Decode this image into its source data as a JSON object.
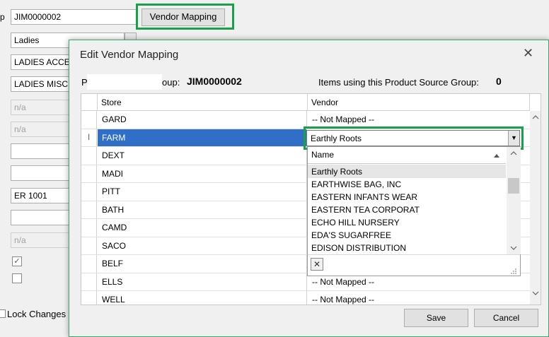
{
  "background": {
    "label_fragment": "p",
    "code_value": "JIM0000002",
    "vendor_mapping_button": "Vendor Mapping",
    "category_value": "Ladies",
    "field3_value": "LADIES ACCE",
    "field4_value": "LADIES MISC",
    "field5_value": "n/a",
    "field6_value": "n/a",
    "field9_value": "ER 1001",
    "field11_value": "n/a",
    "checkbox1": "✓",
    "lock_changes": "Lock Changes"
  },
  "dialog": {
    "title": "Edit Vendor Mapping",
    "close_glyph": "✕",
    "group_label_start": "P",
    "group_label_end": "oup:",
    "group_value": "JIM0000002",
    "items_label": "Items using this Product Source Group:",
    "items_count": "0",
    "grid": {
      "col_store": "Store",
      "col_vendor": "Vendor",
      "rows": [
        {
          "store": "GARD",
          "vendor": "-- Not Mapped --"
        },
        {
          "store": "FARM",
          "vendor": ""
        },
        {
          "store": "DEXT",
          "vendor": ""
        },
        {
          "store": "MADI",
          "vendor": ""
        },
        {
          "store": "PITT",
          "vendor": ""
        },
        {
          "store": "BATH",
          "vendor": ""
        },
        {
          "store": "CAMD",
          "vendor": ""
        },
        {
          "store": "SACO",
          "vendor": ""
        },
        {
          "store": "BELF",
          "vendor": ""
        },
        {
          "store": "ELLS",
          "vendor": "-- Not Mapped --"
        },
        {
          "store": "WELL",
          "vendor": "-- Not Mapped --"
        }
      ],
      "row_cursor": "I"
    },
    "combo_value": "Earthly Roots",
    "dropdown": {
      "header": "Name",
      "items": [
        "Earthly Roots",
        "EARTHWISE BAG, INC",
        "EASTERN INFANTS WEAR",
        "EASTERN TEA CORPORAT",
        "ECHO HILL NURSERY",
        "EDA'S SUGARFREE",
        "EDISON DISTRIBUTION"
      ],
      "clear_glyph": "✕"
    },
    "save_label": "Save",
    "cancel_label": "Cancel"
  },
  "colors": {
    "highlight": "#1aa04a",
    "selection": "#2f6fc7"
  }
}
